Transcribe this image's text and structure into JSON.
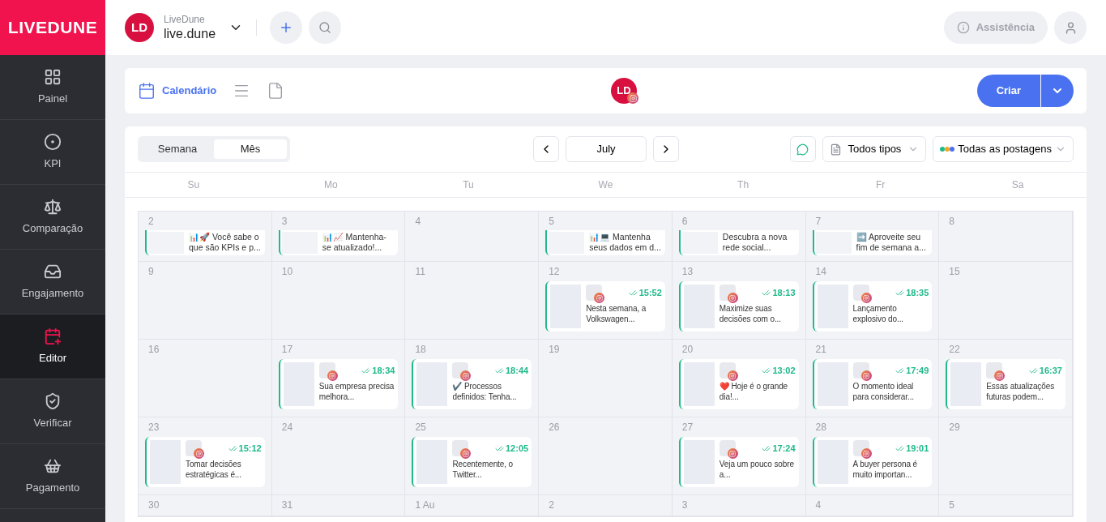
{
  "brand": "LIVEDUNE",
  "sidebar": {
    "items": [
      {
        "label": "Painel",
        "selected": false
      },
      {
        "label": "KPI",
        "selected": false
      },
      {
        "label": "Comparação",
        "selected": false
      },
      {
        "label": "Engajamento",
        "selected": false
      },
      {
        "label": "Editor",
        "selected": true
      },
      {
        "label": "Verificar",
        "selected": false
      },
      {
        "label": "Pagamento",
        "selected": false
      }
    ]
  },
  "account": {
    "initials": "LD",
    "name": "LiveDune",
    "handle": "live.dune"
  },
  "help_button": "Assistência",
  "toolbar": {
    "views": [
      {
        "kind": "calendar",
        "label": "Calendário",
        "selected": true
      },
      {
        "kind": "list",
        "selected": false
      },
      {
        "kind": "file",
        "selected": false
      }
    ],
    "profile_initials": "LD",
    "create_button": "Criar"
  },
  "calendar": {
    "view_tabs": [
      {
        "label": "Semana",
        "selected": false
      },
      {
        "label": "Mês",
        "selected": true
      }
    ],
    "month": "July",
    "type_filter": "Todos tipos",
    "post_filter": "Todas as postagens",
    "weekdays": [
      "Su",
      "Mo",
      "Tu",
      "We",
      "Th",
      "Fr",
      "Sa"
    ],
    "weeks": [
      [
        {
          "day": "2",
          "posts": [
            {
              "text": "📊🚀 Você sabe o que são KPIs e p..."
            }
          ]
        },
        {
          "day": "3",
          "posts": [
            {
              "text": "📊📈 Mantenha-se atualizado!..."
            }
          ]
        },
        {
          "day": "4"
        },
        {
          "day": "5",
          "posts": [
            {
              "text": "📊💻 Mantenha seus dados em d..."
            }
          ]
        },
        {
          "day": "6",
          "posts": [
            {
              "text": "Descubra a nova rede social..."
            }
          ]
        },
        {
          "day": "7",
          "posts": [
            {
              "text": "➡️ Aproveite seu fim de semana a..."
            }
          ]
        },
        {
          "day": "8"
        }
      ],
      [
        {
          "day": "9"
        },
        {
          "day": "10"
        },
        {
          "day": "11"
        },
        {
          "day": "12",
          "posts": [
            {
              "time": "15:52",
              "text": "Nesta semana, a Volkswagen..."
            }
          ]
        },
        {
          "day": "13",
          "posts": [
            {
              "time": "18:13",
              "text": "Maximize suas decisões com o..."
            }
          ]
        },
        {
          "day": "14",
          "posts": [
            {
              "time": "18:35",
              "text": "Lançamento explosivo do..."
            }
          ]
        },
        {
          "day": "15"
        }
      ],
      [
        {
          "day": "16"
        },
        {
          "day": "17",
          "posts": [
            {
              "time": "18:34",
              "text": "Sua empresa precisa melhora..."
            }
          ]
        },
        {
          "day": "18",
          "posts": [
            {
              "time": "18:44",
              "text": "✔️ Processos definidos: Tenha..."
            }
          ]
        },
        {
          "day": "19"
        },
        {
          "day": "20",
          "posts": [
            {
              "time": "13:02",
              "text": "❤️ Hoje é o grande dia!..."
            }
          ]
        },
        {
          "day": "21",
          "posts": [
            {
              "time": "17:49",
              "text": "O momento ideal para considerar..."
            }
          ]
        },
        {
          "day": "22",
          "posts": [
            {
              "time": "16:37",
              "text": "Essas atualizações futuras podem..."
            }
          ]
        }
      ],
      [
        {
          "day": "23",
          "posts": [
            {
              "time": "15:12",
              "text": "Tomar decisões estratégicas é..."
            }
          ]
        },
        {
          "day": "24"
        },
        {
          "day": "25",
          "posts": [
            {
              "time": "12:05",
              "text": "Recentemente, o Twitter..."
            }
          ]
        },
        {
          "day": "26"
        },
        {
          "day": "27",
          "posts": [
            {
              "time": "17:24",
              "text": "Veja um pouco sobre a..."
            }
          ]
        },
        {
          "day": "28",
          "posts": [
            {
              "time": "19:01",
              "text": "A buyer persona é muito importan..."
            }
          ]
        },
        {
          "day": "29"
        }
      ],
      [
        {
          "day": "30"
        },
        {
          "day": "31"
        },
        {
          "day": "1 Au"
        },
        {
          "day": "2"
        },
        {
          "day": "3"
        },
        {
          "day": "4"
        },
        {
          "day": "5"
        }
      ]
    ]
  }
}
